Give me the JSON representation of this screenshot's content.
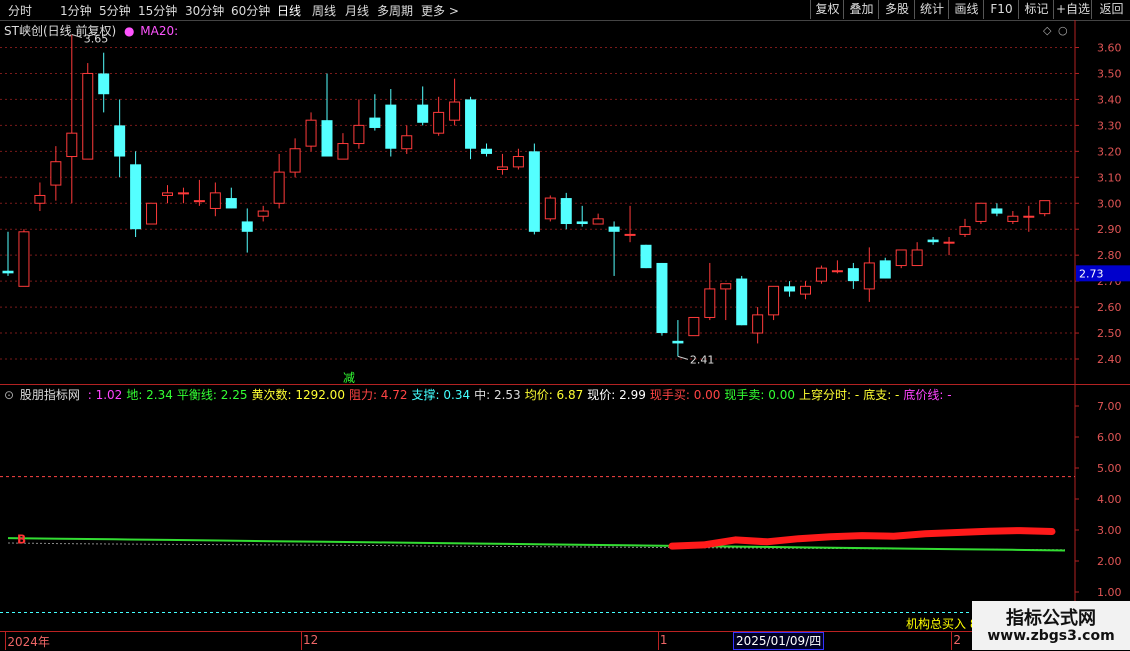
{
  "toolbar": {
    "periods": [
      "分时",
      "1分钟",
      "5分钟",
      "15分钟",
      "30分钟",
      "60分钟",
      "日线",
      "周线",
      "月线",
      "多周期",
      "更多 >"
    ],
    "active_period": "日线",
    "buttons": [
      "复权",
      "叠加",
      "多股",
      "统计",
      "画线",
      "F10",
      "标记",
      "+自选",
      "返回"
    ]
  },
  "main": {
    "title": "ST峡创(日线 前复权)",
    "ma_label": "MA20:",
    "high_label": "3.65",
    "low_label": "2.41",
    "current_price_tag": "2.73",
    "marker_char": "减"
  },
  "indicator": {
    "name": "股朋指标网",
    "items": [
      {
        "label": ": 1.02",
        "color": "#ff44ff"
      },
      {
        "label": "地: 2.34",
        "color": "#33ff33"
      },
      {
        "label": "平衡线: 2.25",
        "color": "#33ff33"
      },
      {
        "label": "黄次数: 1292.00",
        "color": "#ffff33"
      },
      {
        "label": "阻力: 4.72",
        "color": "#ff4444"
      },
      {
        "label": "支撑: 0.34",
        "color": "#44ffff"
      },
      {
        "label": "中: 2.53",
        "color": "#dddddd"
      },
      {
        "label": "均价: 6.87",
        "color": "#ffff33"
      },
      {
        "label": "现价: 2.99",
        "color": "#ffffff"
      },
      {
        "label": "现手买: 0.00",
        "color": "#ff4444"
      },
      {
        "label": "现手卖: 0.00",
        "color": "#33ff33"
      },
      {
        "label": "上穿分时: -",
        "color": "#ffff33"
      },
      {
        "label": "底支: -",
        "color": "#ffff33"
      },
      {
        "label": "底价线: -",
        "color": "#ff44ff"
      }
    ],
    "b_marker": "B",
    "inst_label": "机构总买入 8"
  },
  "dates": {
    "labels": [
      {
        "text": "2024年",
        "pos": 0.005
      },
      {
        "text": "12",
        "pos": 0.28
      },
      {
        "text": "1",
        "pos": 0.612
      },
      {
        "text": "2",
        "pos": 0.885
      }
    ],
    "selected": "2025/01/09/四"
  },
  "watermark": {
    "line1": "指标公式网",
    "line2": "www.zbgs3.com"
  },
  "colors": {
    "up": "#ff3b3b",
    "down": "#54ffff",
    "grid": "#7a1a1a",
    "axis": "#b22222",
    "green_line": "#33dd33",
    "red_band": "#ff1a1a"
  },
  "chart_data": [
    {
      "type": "candlestick",
      "title": "ST峡创(日线 前复权)",
      "ylim": [
        2.35,
        3.72
      ],
      "yticks": [
        2.4,
        2.5,
        2.6,
        2.7,
        2.8,
        2.9,
        3.0,
        3.1,
        3.2,
        3.3,
        3.4,
        3.5,
        3.6
      ],
      "grid": true,
      "candles": [
        {
          "o": 2.74,
          "h": 2.89,
          "l": 2.72,
          "c": 2.73
        },
        {
          "o": 2.68,
          "h": 2.9,
          "l": 2.68,
          "c": 2.89
        },
        {
          "o": 3.0,
          "h": 3.08,
          "l": 2.97,
          "c": 3.03
        },
        {
          "o": 3.07,
          "h": 3.22,
          "l": 3.01,
          "c": 3.16
        },
        {
          "o": 3.18,
          "h": 3.65,
          "l": 3.0,
          "c": 3.27
        },
        {
          "o": 3.17,
          "h": 3.54,
          "l": 3.17,
          "c": 3.5
        },
        {
          "o": 3.5,
          "h": 3.58,
          "l": 3.35,
          "c": 3.42
        },
        {
          "o": 3.3,
          "h": 3.4,
          "l": 3.1,
          "c": 3.18
        },
        {
          "o": 3.15,
          "h": 3.2,
          "l": 2.87,
          "c": 2.9
        },
        {
          "o": 2.92,
          "h": 3.0,
          "l": 2.92,
          "c": 3.0
        },
        {
          "o": 3.03,
          "h": 3.07,
          "l": 3.0,
          "c": 3.04
        },
        {
          "o": 3.04,
          "h": 3.06,
          "l": 3.0,
          "c": 3.04
        },
        {
          "o": 3.01,
          "h": 3.09,
          "l": 2.99,
          "c": 3.01
        },
        {
          "o": 2.98,
          "h": 3.08,
          "l": 2.95,
          "c": 3.04
        },
        {
          "o": 3.02,
          "h": 3.06,
          "l": 2.98,
          "c": 2.98
        },
        {
          "o": 2.93,
          "h": 2.98,
          "l": 2.81,
          "c": 2.89
        },
        {
          "o": 2.95,
          "h": 2.99,
          "l": 2.93,
          "c": 2.97
        },
        {
          "o": 3.0,
          "h": 3.19,
          "l": 2.98,
          "c": 3.12
        },
        {
          "o": 3.12,
          "h": 3.25,
          "l": 3.1,
          "c": 3.21
        },
        {
          "o": 3.22,
          "h": 3.35,
          "l": 3.2,
          "c": 3.32
        },
        {
          "o": 3.32,
          "h": 3.5,
          "l": 3.18,
          "c": 3.18
        },
        {
          "o": 3.17,
          "h": 3.27,
          "l": 3.17,
          "c": 3.23
        },
        {
          "o": 3.23,
          "h": 3.4,
          "l": 3.21,
          "c": 3.3
        },
        {
          "o": 3.33,
          "h": 3.42,
          "l": 3.28,
          "c": 3.29
        },
        {
          "o": 3.38,
          "h": 3.44,
          "l": 3.18,
          "c": 3.21
        },
        {
          "o": 3.21,
          "h": 3.3,
          "l": 3.19,
          "c": 3.26
        },
        {
          "o": 3.38,
          "h": 3.45,
          "l": 3.3,
          "c": 3.31
        },
        {
          "o": 3.27,
          "h": 3.41,
          "l": 3.26,
          "c": 3.35
        },
        {
          "o": 3.32,
          "h": 3.48,
          "l": 3.3,
          "c": 3.39
        },
        {
          "o": 3.4,
          "h": 3.41,
          "l": 3.17,
          "c": 3.21
        },
        {
          "o": 3.21,
          "h": 3.23,
          "l": 3.18,
          "c": 3.19
        },
        {
          "o": 3.13,
          "h": 3.19,
          "l": 3.11,
          "c": 3.14
        },
        {
          "o": 3.14,
          "h": 3.21,
          "l": 3.13,
          "c": 3.18
        },
        {
          "o": 3.2,
          "h": 3.23,
          "l": 2.88,
          "c": 2.89
        },
        {
          "o": 2.94,
          "h": 3.03,
          "l": 2.93,
          "c": 3.02
        },
        {
          "o": 3.02,
          "h": 3.04,
          "l": 2.9,
          "c": 2.92
        },
        {
          "o": 2.93,
          "h": 2.99,
          "l": 2.91,
          "c": 2.92
        },
        {
          "o": 2.92,
          "h": 2.96,
          "l": 2.92,
          "c": 2.94
        },
        {
          "o": 2.91,
          "h": 2.93,
          "l": 2.72,
          "c": 2.89
        },
        {
          "o": 2.88,
          "h": 2.99,
          "l": 2.85,
          "c": 2.88
        },
        {
          "o": 2.84,
          "h": 2.84,
          "l": 2.75,
          "c": 2.75
        },
        {
          "o": 2.77,
          "h": 2.77,
          "l": 2.49,
          "c": 2.5
        },
        {
          "o": 2.47,
          "h": 2.55,
          "l": 2.41,
          "c": 2.46
        },
        {
          "o": 2.49,
          "h": 2.56,
          "l": 2.49,
          "c": 2.56
        },
        {
          "o": 2.56,
          "h": 2.77,
          "l": 2.55,
          "c": 2.67
        },
        {
          "o": 2.67,
          "h": 2.69,
          "l": 2.55,
          "c": 2.69
        },
        {
          "o": 2.71,
          "h": 2.72,
          "l": 2.53,
          "c": 2.53
        },
        {
          "o": 2.5,
          "h": 2.6,
          "l": 2.46,
          "c": 2.57
        },
        {
          "o": 2.57,
          "h": 2.68,
          "l": 2.55,
          "c": 2.68
        },
        {
          "o": 2.68,
          "h": 2.7,
          "l": 2.64,
          "c": 2.66
        },
        {
          "o": 2.65,
          "h": 2.7,
          "l": 2.63,
          "c": 2.68
        },
        {
          "o": 2.7,
          "h": 2.76,
          "l": 2.69,
          "c": 2.75
        },
        {
          "o": 2.74,
          "h": 2.78,
          "l": 2.73,
          "c": 2.74
        },
        {
          "o": 2.75,
          "h": 2.77,
          "l": 2.67,
          "c": 2.7
        },
        {
          "o": 2.67,
          "h": 2.83,
          "l": 2.62,
          "c": 2.77
        },
        {
          "o": 2.78,
          "h": 2.79,
          "l": 2.71,
          "c": 2.71
        },
        {
          "o": 2.76,
          "h": 2.82,
          "l": 2.75,
          "c": 2.82
        },
        {
          "o": 2.76,
          "h": 2.85,
          "l": 2.76,
          "c": 2.82
        },
        {
          "o": 2.86,
          "h": 2.87,
          "l": 2.84,
          "c": 2.85
        },
        {
          "o": 2.85,
          "h": 2.87,
          "l": 2.8,
          "c": 2.85
        },
        {
          "o": 2.88,
          "h": 2.94,
          "l": 2.87,
          "c": 2.91
        },
        {
          "o": 2.93,
          "h": 3.0,
          "l": 2.92,
          "c": 3.0
        },
        {
          "o": 2.98,
          "h": 3.0,
          "l": 2.95,
          "c": 2.96
        },
        {
          "o": 2.93,
          "h": 2.97,
          "l": 2.92,
          "c": 2.95
        },
        {
          "o": 2.95,
          "h": 2.99,
          "l": 2.89,
          "c": 2.95
        },
        {
          "o": 2.96,
          "h": 3.01,
          "l": 2.95,
          "c": 3.01
        }
      ]
    },
    {
      "type": "line",
      "title": "股朋指标网",
      "ylim": [
        0.9,
        7.4
      ],
      "yticks": [
        1.0,
        2.0,
        3.0,
        4.0,
        5.0,
        6.0,
        7.0
      ],
      "reference_lines": [
        {
          "y": 4.72,
          "color": "#ff4444",
          "style": "dashed"
        },
        {
          "y": 0.34,
          "color": "#44ffff",
          "style": "dashed"
        }
      ],
      "series": [
        {
          "color": "#33dd33",
          "values": [
            2.74,
            2.72,
            2.7,
            2.68,
            2.66,
            2.64,
            2.62,
            2.6,
            2.58,
            2.56,
            2.54,
            2.52,
            2.5,
            2.48,
            2.46,
            2.44,
            2.42,
            2.4,
            2.38,
            2.36,
            2.34
          ]
        },
        {
          "color": "#888888",
          "style": "dashed",
          "values": [
            2.58,
            2.56,
            2.55,
            2.54,
            2.53,
            2.52,
            2.51,
            2.5,
            2.48,
            2.47,
            2.46,
            2.45,
            2.44,
            2.43,
            2.42,
            2.41,
            2.4,
            2.39,
            2.38,
            2.37,
            2.36
          ]
        },
        {
          "color": "#ff1a1a",
          "start_index": 12,
          "values": [
            2.48,
            2.52,
            2.68,
            2.62,
            2.72,
            2.78,
            2.82,
            2.8,
            2.88,
            2.92,
            2.96,
            2.98,
            2.95
          ]
        }
      ]
    }
  ]
}
